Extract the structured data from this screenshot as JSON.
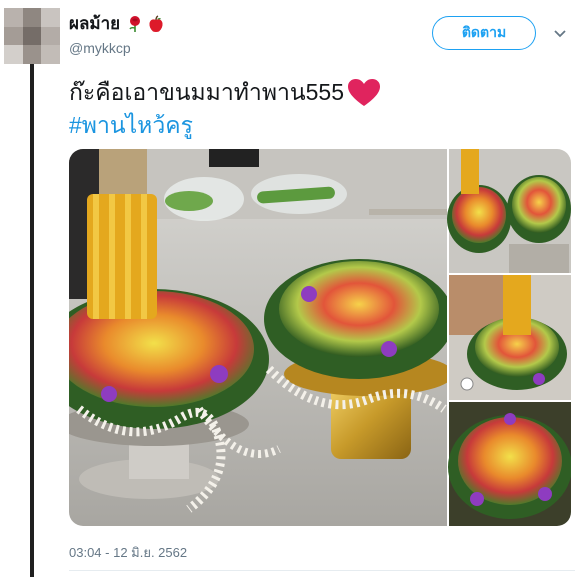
{
  "tweet": {
    "display_name": "ผลม้าย",
    "handle": "@mykkcp",
    "follow_label": "ติดตาม",
    "text_line": "ก๊ะคือเอาขนมมาทำพาน555",
    "hashtag": "#พานไหว้ครู",
    "timestamp": "03:04 - 12 มิ.ย. 2562",
    "name_emojis": [
      "rose-icon",
      "apple-icon"
    ],
    "text_emoji": "red-heart-icon"
  },
  "colors": {
    "link": "#1b95e0",
    "follow_border": "#1da1f2",
    "secondary_text": "#657786",
    "heart": "#e0245e"
  }
}
